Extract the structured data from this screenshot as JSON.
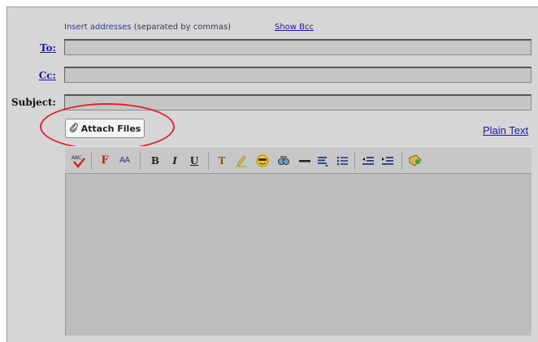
{
  "compose": {
    "hint_prefix": "Insert addresses",
    "hint_suffix": "(separated by commas)",
    "show_bcc": "Show Bcc",
    "to_label": "To:",
    "cc_label": "Cc:",
    "subject_label": "Subject:",
    "to_value": "",
    "cc_value": "",
    "subject_value": "",
    "attach_label": "Attach Files",
    "plain_text_link": "Plain Text"
  },
  "toolbar": {
    "spellcheck": "ABC",
    "font_face": "F",
    "font_size": "AA",
    "bold": "B",
    "italic": "I",
    "underline": "U",
    "text_color": "T"
  },
  "colors": {
    "highlight_ring": "#e0252a",
    "link": "#1a1aa6",
    "panel_bg": "#d6d6d6",
    "editor_bg": "#bcbcbc"
  }
}
